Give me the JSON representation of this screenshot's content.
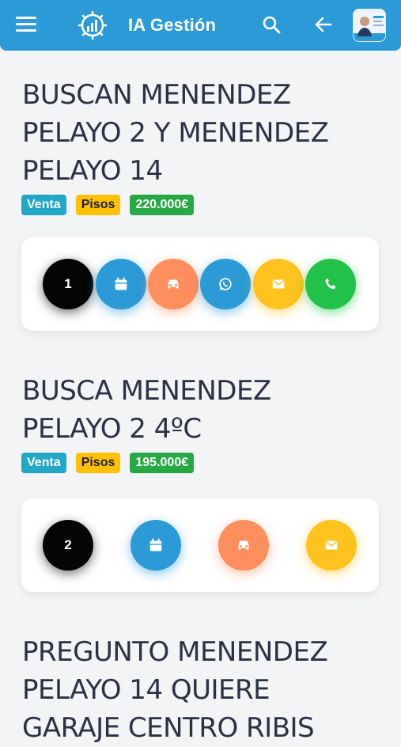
{
  "app": {
    "title": "IA Gestión"
  },
  "icons": [
    "menu-icon",
    "logo-gear-chart-icon",
    "search-icon",
    "back-arrow-icon",
    "avatar-image"
  ],
  "colors": {
    "topbar": "#2b9ad6",
    "badge_blue": "#22a7c4",
    "badge_yellow": "#ffc107",
    "badge_green": "#28a745"
  },
  "listings": [
    {
      "title": "BUSCAN MENENDEZ PELAYO 2 Y MENENDEZ PELAYO 14",
      "operation": "Venta",
      "type": "Pisos",
      "price": "220.000€",
      "count": "1",
      "actions": [
        "calendar",
        "car",
        "whatsapp",
        "email",
        "phone"
      ]
    },
    {
      "title": "BUSCA MENENDEZ PELAYO 2 4ºC",
      "operation": "Venta",
      "type": "Pisos",
      "price": "195.000€",
      "count": "2",
      "actions": [
        "calendar",
        "car",
        "email"
      ]
    },
    {
      "title": "PREGUNTO MENENDEZ PELAYO 14 QUIERE GARAJE CENTRO RIBIS"
    }
  ]
}
